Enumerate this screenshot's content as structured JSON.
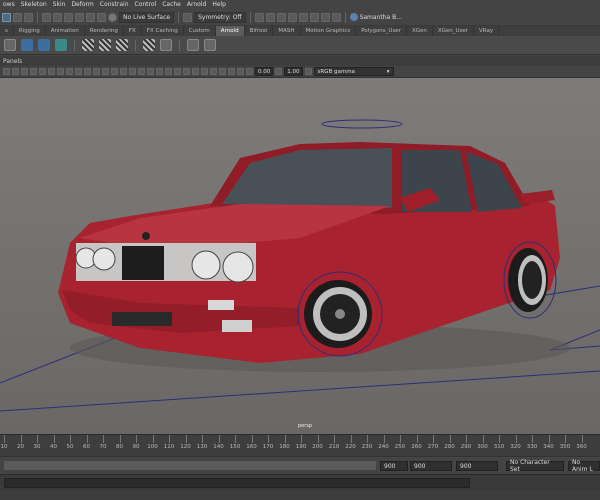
{
  "menu": [
    "ows",
    "Skeleton",
    "Skin",
    "Deform",
    "Constrain",
    "Control",
    "Cache",
    "Arnold",
    "Help"
  ],
  "status": {
    "live_surface": "No Live Surface",
    "symmetry": "Symmetry: Off",
    "user": "Samantha B..."
  },
  "shelf_tabs": [
    "s",
    "Rigging",
    "Animation",
    "Rendering",
    "FX",
    "FX Caching",
    "Custom",
    "Arnold",
    "Bifrost",
    "MASH",
    "Motion Graphics",
    "Polygons_User",
    "XGen",
    "XGen_User",
    "VRay"
  ],
  "shelf_tab_selected": "Arnold",
  "panels_label": "Panels",
  "viewport_toolbar": {
    "exposure": "0.00",
    "gamma": "1.00",
    "color_space": "sRGB gamma"
  },
  "camera_label": "persp",
  "timeline": {
    "tick_labels": [
      "10",
      "20",
      "30",
      "40",
      "50",
      "60",
      "70",
      "80",
      "90",
      "100",
      "110",
      "120",
      "130",
      "140",
      "150",
      "160",
      "170",
      "180",
      "190",
      "200",
      "210",
      "220",
      "230",
      "240",
      "250",
      "260",
      "270",
      "280",
      "290",
      "300",
      "310",
      "320",
      "330",
      "340",
      "350",
      "360"
    ]
  },
  "range": {
    "end_frame": "900",
    "anim_end": "900",
    "playback_end": "900",
    "character_set": "No Character Set",
    "anim_layer": "No Anim L"
  },
  "colors": {
    "car_body": "#a8232f",
    "viewport_bg": "#767371",
    "grid_line": "#2a2f7a"
  }
}
